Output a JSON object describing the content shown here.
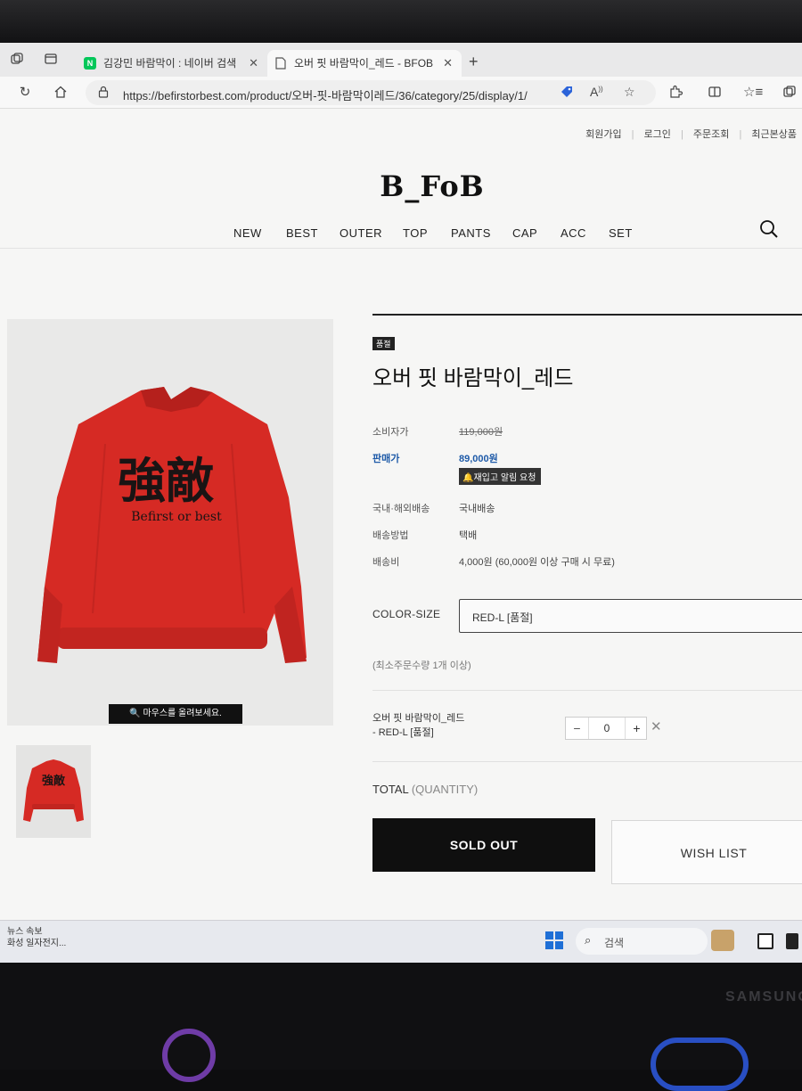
{
  "browser": {
    "tabs": [
      {
        "title": "김강민 바람막이 : 네이버 검색",
        "favicon": "N",
        "favicon_color": "#03c75a"
      },
      {
        "title": "오버 핏 바람막이_레드 - BFOB",
        "favicon": "page-icon"
      }
    ],
    "url": "https://befirstorbest.com/product/오버-핏-바람막이레드/36/category/25/display/1/"
  },
  "site": {
    "top_links": [
      "회원가입",
      "로그인",
      "주문조회",
      "최근본상품"
    ],
    "logo": "B_FoB",
    "nav": [
      "NEW",
      "BEST",
      "OUTER",
      "TOP",
      "PANTS",
      "CAP",
      "ACC",
      "SET"
    ]
  },
  "product": {
    "image_hint": "마우스를 올려보세요.",
    "jacket_print_hanja": "強敵",
    "jacket_print_text": "Befirst or best",
    "badge": "품절",
    "name": "오버 핏 바람막이_레드",
    "rows": {
      "consumer_price_label": "소비자가",
      "consumer_price": "119,000원",
      "sale_price_label": "판매가",
      "sale_price": "89,000원",
      "restock_button": "재입고 알림 요청",
      "shipping_region_label": "국내·해외배송",
      "shipping_region": "국내배송",
      "shipping_method_label": "배송방법",
      "shipping_method": "택배",
      "shipping_fee_label": "배송비",
      "shipping_fee": "4,000원 (60,000원 이상 구매 시 무료)"
    },
    "option_label": "COLOR-SIZE",
    "option_selected": "RED-L [품절]",
    "min_qty_note": "(최소주문수량 1개 이상)",
    "selected_item_name": "오버 핏 바람막이_레드",
    "selected_item_option": "- RED-L [품절]",
    "qty_minus": "−",
    "qty_value": "0",
    "qty_plus": "+",
    "remove": "✕",
    "total_label": "TOTAL",
    "total_qty_label": "(QUANTITY)",
    "sold_out_button": "SOLD OUT",
    "wish_button": "WISH LIST",
    "accent_red": "#d62a24"
  },
  "taskbar": {
    "news_line1": "뉴스 속보",
    "news_line2": "화성 일자전지...",
    "search_label": "검색"
  },
  "monitor": {
    "brand": "SAMSUNG"
  }
}
